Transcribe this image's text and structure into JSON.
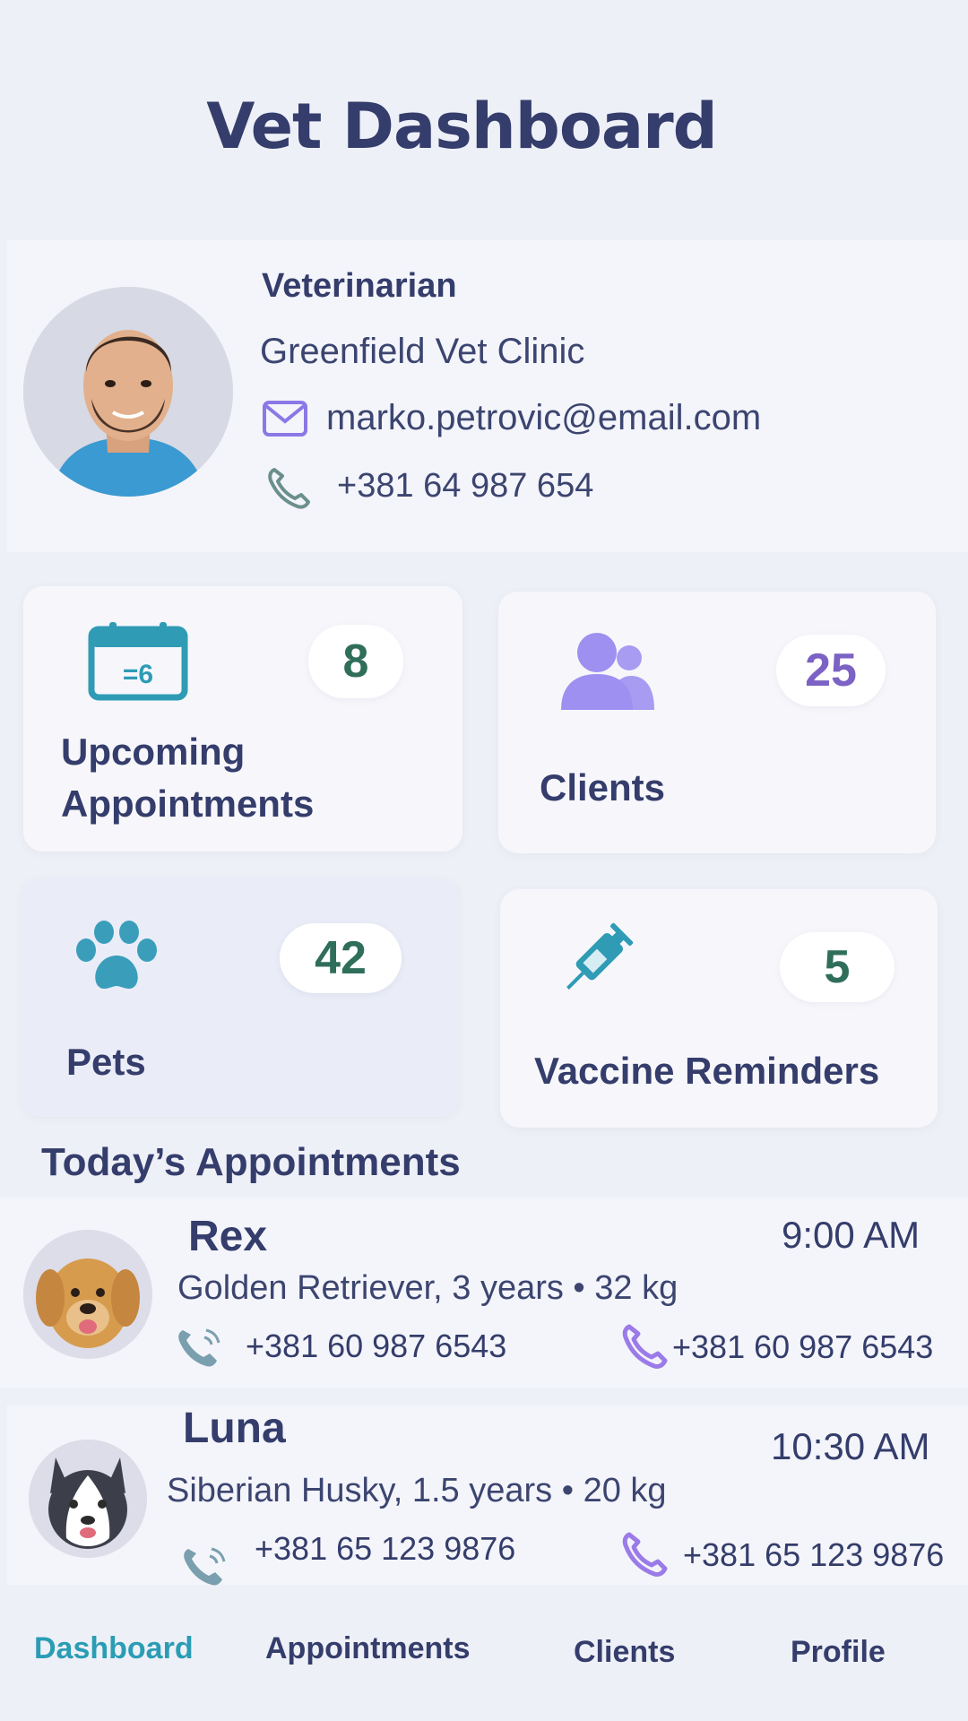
{
  "header": {
    "title": "Vet Dashboard"
  },
  "profile": {
    "role": "Veterinarian",
    "clinic": "Greenfield Vet Clinic",
    "email": "marko.petrovic@email.com",
    "phone": "+381 64 987 654",
    "icons": {
      "email": "mail-icon",
      "phone": "phone-icon"
    }
  },
  "stats": [
    {
      "label": "Upcoming Appointments",
      "value": "8",
      "icon": "calendar-icon",
      "calendar_text": "=6",
      "value_color": "#2f6e5a"
    },
    {
      "label": "Clients",
      "value": "25",
      "icon": "users-icon",
      "value_color": "#7b62c4"
    },
    {
      "label": "Pets",
      "value": "42",
      "icon": "paw-icon",
      "value_color": "#2f6e5a"
    },
    {
      "label": "Vaccine Reminders",
      "value": "5",
      "icon": "syringe-icon",
      "value_color": "#2f6e5a"
    }
  ],
  "appointments_section": {
    "title": "Today’s Appointments"
  },
  "appointments": [
    {
      "name": "Rex",
      "time": "9:00 AM",
      "details": "Golden Retriever, 3 years • 32 kg",
      "phone_left": "+381 60 987 6543",
      "phone_right": "+381 60 987 6543"
    },
    {
      "name": "Luna",
      "time": "10:30 AM",
      "details": "Siberian Husky, 1.5 years • 20 kg",
      "phone_left": "+381 65 123 9876",
      "phone_right": "+381 65 123 9876"
    }
  ],
  "nav": [
    {
      "label": "Dashboard",
      "active": true
    },
    {
      "label": "Appointments",
      "active": false
    },
    {
      "label": "Clients",
      "active": false
    },
    {
      "label": "Profile",
      "active": false
    }
  ],
  "colors": {
    "primary_text": "#343d6b",
    "accent_teal": "#2a9db5",
    "accent_purple": "#8b78e6",
    "background": "#eef0f7"
  }
}
